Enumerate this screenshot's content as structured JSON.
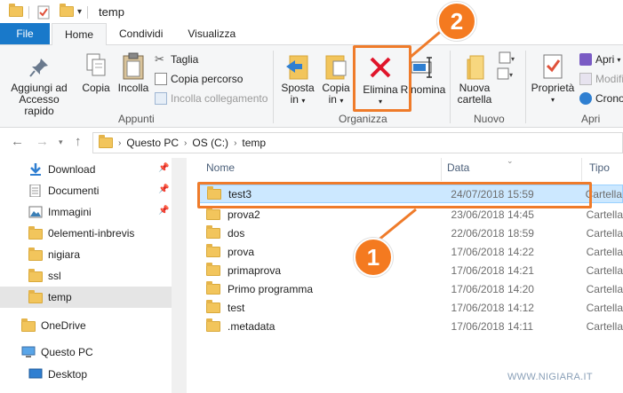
{
  "window": {
    "title": "temp"
  },
  "tabs": [
    {
      "label": "File"
    },
    {
      "label": "Home"
    },
    {
      "label": "Condividi"
    },
    {
      "label": "Visualizza"
    }
  ],
  "ribbon": {
    "appunti": {
      "group_label": "Appunti",
      "pin_label_1": "Aggiungi ad",
      "pin_label_2": "Accesso rapido",
      "copia": "Copia",
      "incolla": "Incolla",
      "taglia": "Taglia",
      "copia_percorso": "Copia percorso",
      "incolla_collegamento": "Incolla collegamento"
    },
    "organizza": {
      "group_label": "Organizza",
      "sposta_1": "Sposta",
      "sposta_2": "in",
      "copia_1": "Copia",
      "copia_2": "in",
      "elimina": "Elimina",
      "rinomina": "Rinomina"
    },
    "nuovo": {
      "group_label": "Nuovo",
      "nuova_1": "Nuova",
      "nuova_2": "cartella"
    },
    "apri": {
      "group_label": "Apri",
      "proprieta": "Proprietà",
      "apri": "Apri",
      "modifica": "Modifi",
      "cronologia": "Crono"
    }
  },
  "address": {
    "crumbs": [
      "Questo PC",
      "OS (C:)",
      "temp"
    ]
  },
  "nav": {
    "items": [
      {
        "label": "Download",
        "icon": "download-icon",
        "pinned": true
      },
      {
        "label": "Documenti",
        "icon": "documents-icon",
        "pinned": true
      },
      {
        "label": "Immagini",
        "icon": "pictures-icon",
        "pinned": true
      },
      {
        "label": "0elementi-inbrevis",
        "icon": "folder-icon"
      },
      {
        "label": "nigiara",
        "icon": "folder-icon"
      },
      {
        "label": "ssl",
        "icon": "folder-icon"
      },
      {
        "label": "temp",
        "icon": "folder-icon",
        "selected": true
      },
      {
        "label": "OneDrive",
        "icon": "folder-icon"
      },
      {
        "label": "Questo PC",
        "icon": "computer-icon"
      },
      {
        "label": "Desktop",
        "icon": "desktop-icon"
      }
    ]
  },
  "list": {
    "columns": {
      "name": "Nome",
      "date": "Data",
      "type": "Tipo"
    },
    "rows": [
      {
        "name": "test3",
        "date": "24/07/2018 15:59",
        "type": "Cartella",
        "selected": true
      },
      {
        "name": "prova2",
        "date": "23/06/2018 14:45",
        "type": "Cartella"
      },
      {
        "name": "dos",
        "date": "22/06/2018 18:59",
        "type": "Cartella"
      },
      {
        "name": "prova",
        "date": "17/06/2018 14:22",
        "type": "Cartella"
      },
      {
        "name": "primaprova",
        "date": "17/06/2018 14:21",
        "type": "Cartella"
      },
      {
        "name": "Primo programma",
        "date": "17/06/2018 14:20",
        "type": "Cartella"
      },
      {
        "name": "test",
        "date": "17/06/2018 14:12",
        "type": "Cartella"
      },
      {
        "name": ".metadata",
        "date": "17/06/2018 14:11",
        "type": "Cartella"
      }
    ]
  },
  "annotations": {
    "step1": "1",
    "step2": "2"
  },
  "watermark": "WWW.NIGIARA.IT",
  "colors": {
    "accent": "#1979ca",
    "annotation": "#f47a20",
    "selection": "#cce8ff"
  }
}
